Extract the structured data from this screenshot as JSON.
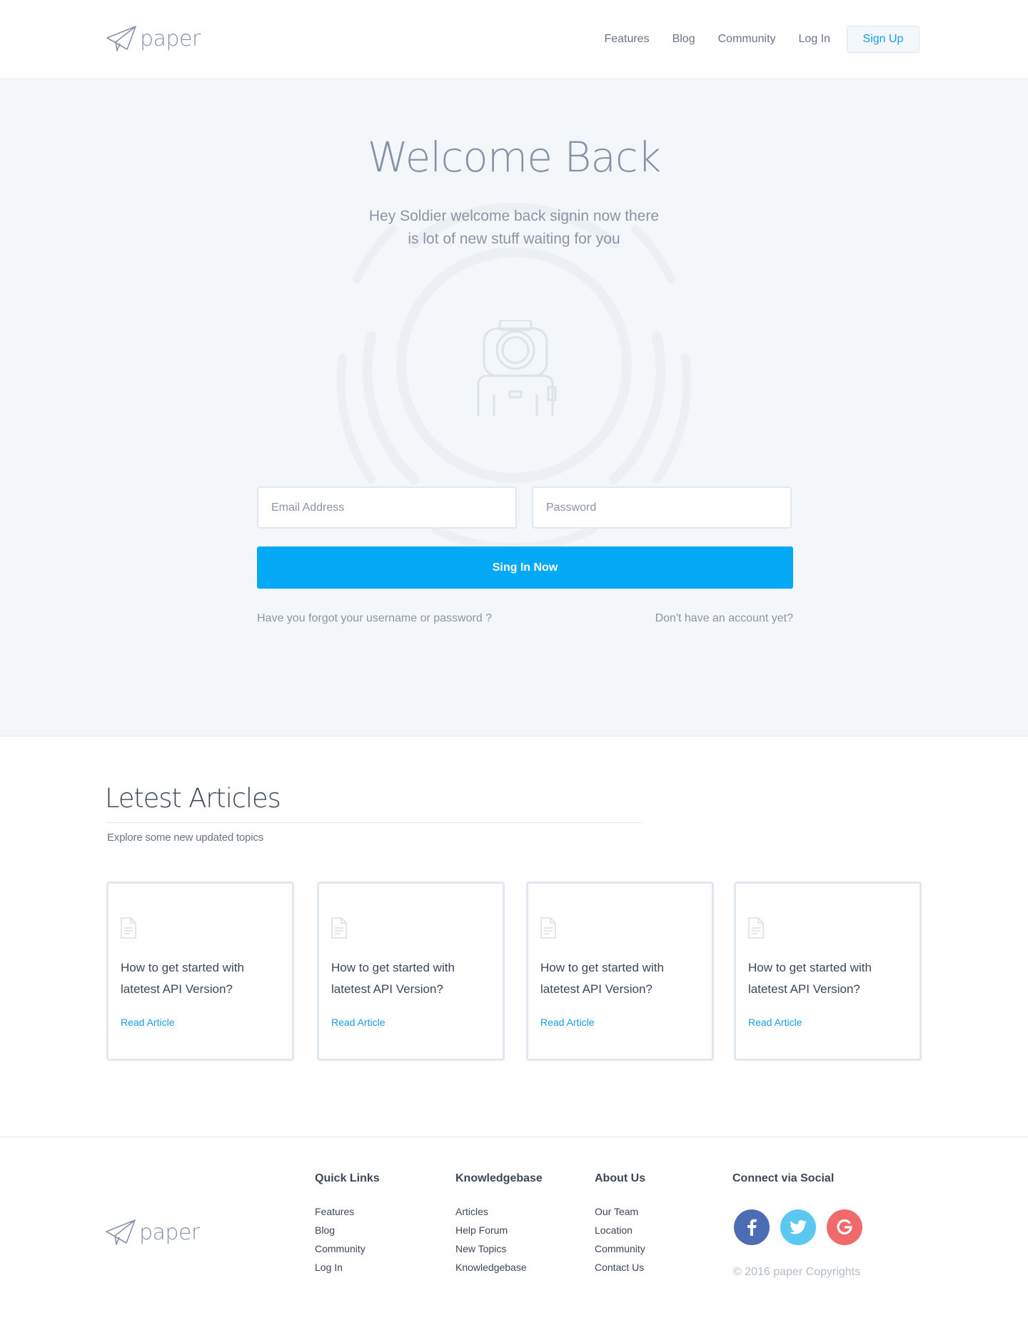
{
  "brand": {
    "name": "paper"
  },
  "nav": {
    "items": [
      "Features",
      "Blog",
      "Community",
      "Log In"
    ],
    "signup": "Sign Up"
  },
  "hero": {
    "title": "Welcome Back",
    "subtitle": "Hey Soldier welcome back signin now there is lot of new stuff waiting for you",
    "email_placeholder": "Email Address",
    "password_placeholder": "Password",
    "signin_label": "Sing In Now",
    "forgot_link": "Have you forgot your username or password ?",
    "no_account_link": "Don't have an account yet?"
  },
  "articles": {
    "title": "Letest Articles",
    "subtitle": "Explore some new updated topics",
    "cards": [
      {
        "title": "How to get started with latetest API Version?",
        "link": "Read Article"
      },
      {
        "title": "How to get started with latetest API Version?",
        "link": "Read Article"
      },
      {
        "title": "How to get started with latetest API Version?",
        "link": "Read Article"
      },
      {
        "title": "How to get started with latetest API Version?",
        "link": "Read Article"
      }
    ]
  },
  "footer": {
    "columns": [
      {
        "title": "Quick Links",
        "links": [
          "Features",
          "Blog",
          "Community",
          "Log In"
        ]
      },
      {
        "title": "Knowledgebase",
        "links": [
          "Articles",
          "Help Forum",
          "New Topics",
          "Knowledgebase"
        ]
      },
      {
        "title": "About Us",
        "links": [
          "Our Team",
          "Location",
          "Community",
          "Contact Us"
        ]
      }
    ],
    "social": {
      "title": "Connect via Social",
      "networks": [
        {
          "icon": "facebook-icon",
          "color": "#4c6cb5",
          "glyph": "f"
        },
        {
          "icon": "twitter-icon",
          "color": "#5bc8f2",
          "glyph": "t"
        },
        {
          "icon": "google-icon",
          "color": "#f16a6a",
          "glyph": "G"
        }
      ]
    },
    "copyright": "© 2016 paper Copyrights"
  },
  "colors": {
    "accent": "#03a9f4",
    "link": "#1a9ce8",
    "hero_bg": "#f4f7fa"
  }
}
